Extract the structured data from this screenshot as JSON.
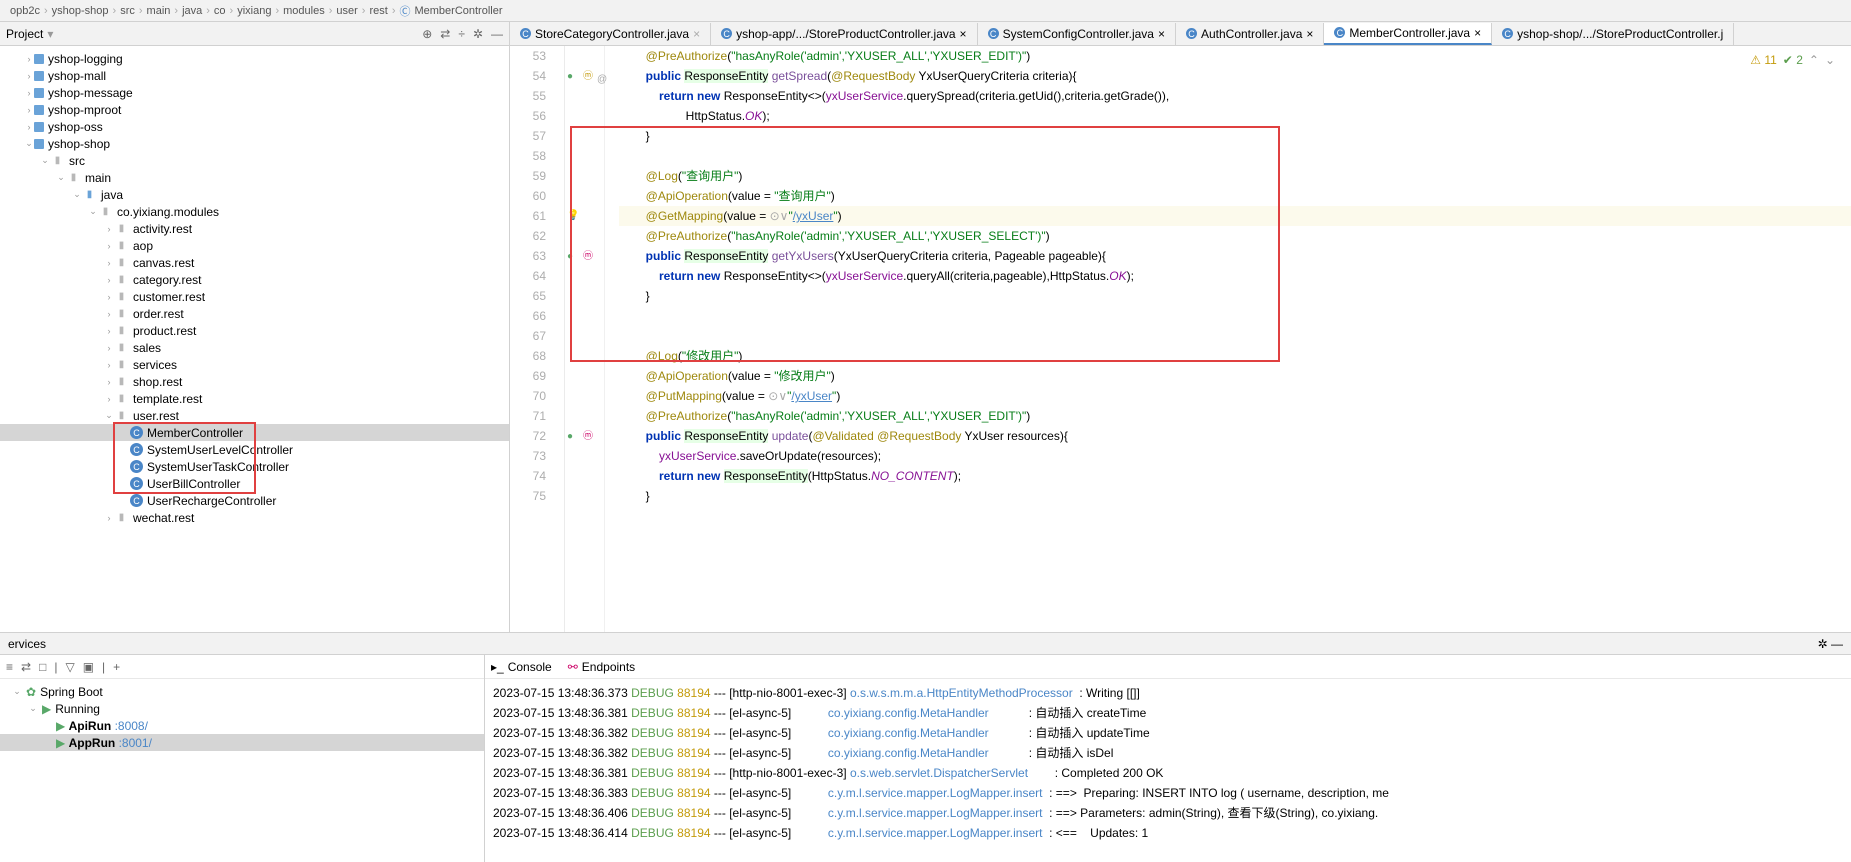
{
  "breadcrumb": [
    "opb2c",
    "yshop-shop",
    "src",
    "main",
    "java",
    "co",
    "yixiang",
    "modules",
    "user",
    "rest",
    "MemberController"
  ],
  "project": {
    "label": "Project"
  },
  "tree": {
    "mods": [
      "yshop-logging",
      "yshop-mall",
      "yshop-message",
      "yshop-mproot",
      "yshop-oss",
      "yshop-shop"
    ],
    "src": "src",
    "main": "main",
    "java": "java",
    "pkg": "co.yixiang.modules",
    "pkgs": [
      "activity.rest",
      "aop",
      "canvas.rest",
      "category.rest",
      "customer.rest",
      "order.rest",
      "product.rest",
      "sales",
      "services",
      "shop.rest",
      "template.rest",
      "user.rest"
    ],
    "classes": [
      "MemberController",
      "SystemUserLevelController",
      "SystemUserTaskController",
      "UserBillController",
      "UserRechargeController"
    ],
    "last": "wechat.rest"
  },
  "tabs": [
    "StoreCategoryController.java",
    "yshop-app/.../StoreProductController.java",
    "SystemConfigController.java",
    "AuthController.java",
    "MemberController.java",
    "yshop-shop/.../StoreProductController.j"
  ],
  "lines": [
    53,
    54,
    55,
    56,
    57,
    58,
    59,
    60,
    61,
    62,
    63,
    64,
    65,
    66,
    67,
    68,
    69,
    70,
    71,
    72,
    73,
    74,
    75
  ],
  "inspect": {
    "warn": "11",
    "ok": "2"
  },
  "services": {
    "label": "ervices"
  },
  "spring": "Spring Boot",
  "running": "Running",
  "runs": [
    {
      "name": "ApiRun",
      "port": ":8008/"
    },
    {
      "name": "AppRun",
      "port": ":8001/"
    }
  ],
  "consoleTabs": [
    "Console",
    "Endpoints"
  ],
  "log": [
    {
      "t": "2023-07-15 13:48:36.373",
      "l": "DEBUG",
      "p": "88194",
      "th": "[http-nio-8001-exec-3]",
      "c": "o.s.w.s.m.m.a.HttpEntityMethodProcessor",
      "m": ": Writing [[]]"
    },
    {
      "t": "2023-07-15 13:48:36.381",
      "l": "DEBUG",
      "p": "88194",
      "th": "[el-async-5]",
      "c": "co.yixiang.config.MetaHandler",
      "m": ": 自动插入 createTime"
    },
    {
      "t": "2023-07-15 13:48:36.382",
      "l": "DEBUG",
      "p": "88194",
      "th": "[el-async-5]",
      "c": "co.yixiang.config.MetaHandler",
      "m": ": 自动插入 updateTime"
    },
    {
      "t": "2023-07-15 13:48:36.382",
      "l": "DEBUG",
      "p": "88194",
      "th": "[el-async-5]",
      "c": "co.yixiang.config.MetaHandler",
      "m": ": 自动插入 isDel"
    },
    {
      "t": "2023-07-15 13:48:36.381",
      "l": "DEBUG",
      "p": "88194",
      "th": "[http-nio-8001-exec-3]",
      "c": "o.s.web.servlet.DispatcherServlet",
      "m": ": Completed 200 OK"
    },
    {
      "t": "2023-07-15 13:48:36.383",
      "l": "DEBUG",
      "p": "88194",
      "th": "[el-async-5]",
      "c": "c.y.m.l.service.mapper.LogMapper.insert",
      "m": ": ==>  Preparing: INSERT INTO log ( username, description, me"
    },
    {
      "t": "2023-07-15 13:48:36.406",
      "l": "DEBUG",
      "p": "88194",
      "th": "[el-async-5]",
      "c": "c.y.m.l.service.mapper.LogMapper.insert",
      "m": ": ==> Parameters: admin(String), 查看下级(String), co.yixiang."
    },
    {
      "t": "2023-07-15 13:48:36.414",
      "l": "DEBUG",
      "p": "88194",
      "th": "[el-async-5]",
      "c": "c.y.m.l.service.mapper.LogMapper.insert",
      "m": ": <==    Updates: 1"
    }
  ]
}
